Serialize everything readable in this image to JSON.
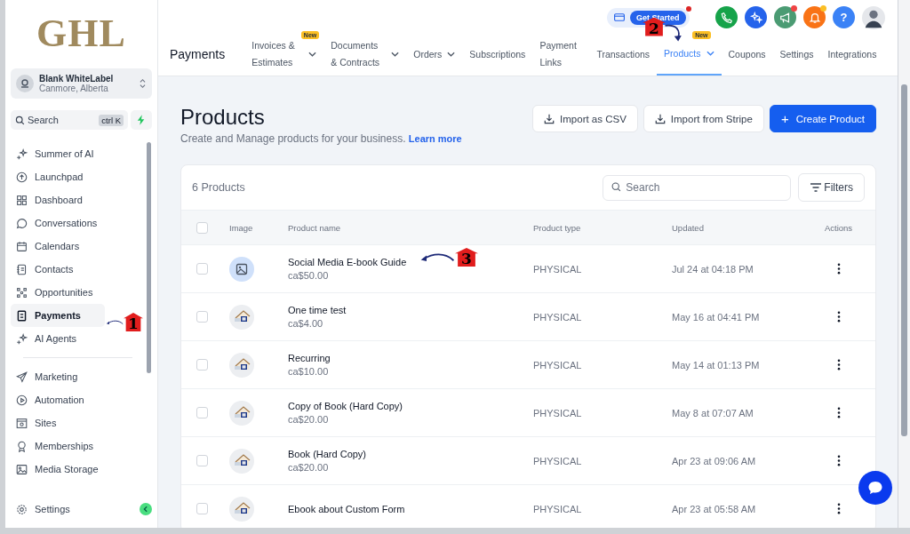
{
  "brand": {
    "logo": "GHL"
  },
  "account": {
    "name": "Blank WhiteLabel",
    "location": "Canmore, Alberta"
  },
  "sidebar_search": {
    "placeholder": "Search",
    "shortcut": "ctrl K"
  },
  "sidebar": {
    "items": [
      {
        "label": "Summer of AI",
        "selected": false
      },
      {
        "label": "Launchpad",
        "selected": false
      },
      {
        "label": "Dashboard",
        "selected": false
      },
      {
        "label": "Conversations",
        "selected": false
      },
      {
        "label": "Calendars",
        "selected": false
      },
      {
        "label": "Contacts",
        "selected": false
      },
      {
        "label": "Opportunities",
        "selected": false
      },
      {
        "label": "Payments",
        "selected": true
      },
      {
        "label": "AI Agents",
        "selected": false
      }
    ],
    "items_2": [
      {
        "label": "Marketing",
        "selected": false
      },
      {
        "label": "Automation",
        "selected": false
      },
      {
        "label": "Sites",
        "selected": false
      },
      {
        "label": "Memberships",
        "selected": false
      },
      {
        "label": "Media Storage",
        "selected": false
      }
    ],
    "footer": {
      "label": "Settings"
    }
  },
  "header": {
    "title": "Payments",
    "get_started": "Get Started",
    "tabs": [
      {
        "label": "Invoices & Estimates",
        "selected": false,
        "dropdown": true,
        "badge": "New"
      },
      {
        "label": "Documents & Contracts",
        "selected": false,
        "dropdown": true
      },
      {
        "label": "Orders",
        "selected": false,
        "dropdown": true
      },
      {
        "label": "Subscriptions",
        "selected": false,
        "dropdown": false
      },
      {
        "label": "Payment Links",
        "selected": false,
        "dropdown": false
      },
      {
        "label": "Transactions",
        "selected": false,
        "dropdown": false
      },
      {
        "label": "Products",
        "selected": true,
        "dropdown": true,
        "badge": "New"
      },
      {
        "label": "Coupons",
        "selected": false,
        "dropdown": false
      },
      {
        "label": "Settings",
        "selected": false,
        "dropdown": false
      },
      {
        "label": "Integrations",
        "selected": false,
        "dropdown": false
      }
    ],
    "actions": [
      {
        "kind": "phone",
        "color": "#16a34a",
        "dot": false
      },
      {
        "kind": "sparkle",
        "color": "#2563eb",
        "dot": false
      },
      {
        "kind": "megaphone",
        "color": "#4b9b73",
        "dot": true
      },
      {
        "kind": "bell",
        "color": "#f97316",
        "dot": true
      },
      {
        "kind": "help",
        "color": "#3b82f6",
        "dot": false,
        "text": "?"
      }
    ]
  },
  "page": {
    "title": "Products",
    "subtitle": "Create and Manage products for your business.",
    "learn_more": "Learn more",
    "buttons": [
      {
        "label": "Import as CSV",
        "kind": "import"
      },
      {
        "label": "Import from Stripe",
        "kind": "import"
      },
      {
        "label": "Create Product",
        "kind": "primary",
        "icon": "+"
      }
    ]
  },
  "table": {
    "count": "6 Products",
    "search_placeholder": "Search",
    "filters": "Filters",
    "select_all_checked": false,
    "columns": [
      "Image",
      "Product name",
      "Product type",
      "Updated",
      "Actions"
    ],
    "rows": [
      {
        "name": "Social Media E-book Guide",
        "price": "ca$50.00",
        "type": "PHYSICAL",
        "updated": "Jul 24 at 04:18 PM",
        "kind": "placeholder",
        "checked": false
      },
      {
        "name": "One time test",
        "price": "ca$4.00",
        "type": "PHYSICAL",
        "updated": "May 16 at 04:41 PM",
        "checked": false
      },
      {
        "name": "Recurring",
        "price": "ca$10.00",
        "type": "PHYSICAL",
        "updated": "May 14 at 01:13 PM",
        "checked": false
      },
      {
        "name": "Copy of Book (Hard Copy)",
        "price": "ca$20.00",
        "type": "PHYSICAL",
        "updated": "May 8 at 07:07 AM",
        "checked": false
      },
      {
        "name": "Book (Hard Copy)",
        "price": "ca$20.00",
        "type": "PHYSICAL",
        "updated": "Apr 23 at 09:06 AM",
        "checked": false
      },
      {
        "name": "Ebook about Custom Form",
        "type": "PHYSICAL",
        "updated": "Apr 23 at 05:58 AM",
        "checked": false
      }
    ]
  },
  "annotations": [
    {
      "number": "1"
    },
    {
      "number": "2"
    },
    {
      "number": "3"
    }
  ]
}
